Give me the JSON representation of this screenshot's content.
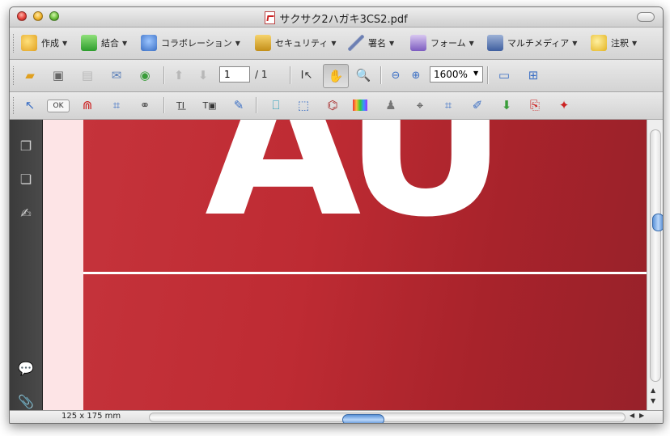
{
  "window": {
    "title": "サクサク2ハガキ3CS2.pdf"
  },
  "tasks_toolbar": [
    {
      "label": "作成",
      "icon": "create-pdf-icon"
    },
    {
      "label": "結合",
      "icon": "combine-icon"
    },
    {
      "label": "コラボレーション",
      "icon": "collaborate-icon"
    },
    {
      "label": "セキュリティ",
      "icon": "lock-icon"
    },
    {
      "label": "署名",
      "icon": "pen-sign-icon"
    },
    {
      "label": "フォーム",
      "icon": "form-icon"
    },
    {
      "label": "マルチメディア",
      "icon": "film-icon"
    },
    {
      "label": "注釈",
      "icon": "comment-icon"
    }
  ],
  "nav_toolbar": {
    "page_current": "1",
    "page_total": "/ 1",
    "zoom": "1600%"
  },
  "edit_toolbar": {
    "ok_label": "OK"
  },
  "document": {
    "big_text": "AU"
  },
  "status": {
    "page_size": "125 x 175 mm"
  },
  "colors": {
    "page_red": "#be2b33",
    "page_bg_pink": "#fde4e6",
    "nav_pane": "#3b3b3b",
    "scroll_thumb": "#5b93d8"
  }
}
